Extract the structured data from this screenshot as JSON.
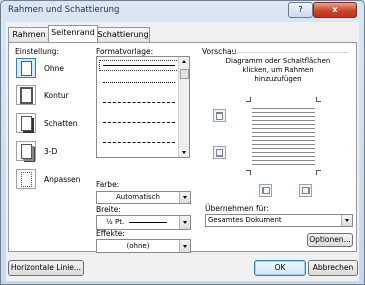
{
  "window": {
    "title": "Rahmen und Schattierung",
    "help_label": "?",
    "close_label": "x"
  },
  "tabs": [
    {
      "label": "Rahmen"
    },
    {
      "label": "Seitenrand"
    },
    {
      "label": "Schattierung"
    }
  ],
  "settings": {
    "heading": "Einstellung:",
    "items": [
      {
        "label": "Ohne"
      },
      {
        "label": "Kontur"
      },
      {
        "label": "Schatten"
      },
      {
        "label": "3-D"
      },
      {
        "label": "Anpassen"
      }
    ]
  },
  "style": {
    "heading": "Formatvorlage:"
  },
  "color": {
    "label": "Farbe:",
    "value": "Automatisch"
  },
  "width": {
    "label": "Breite:",
    "value": "½ Pt."
  },
  "effect": {
    "label": "Effekte:",
    "value": "(ohne)"
  },
  "preview": {
    "heading": "Vorschau",
    "hint_line1": "Diagramm oder Schaltflächen",
    "hint_line2": "klicken, um Rahmen",
    "hint_line3": "hinzuzufügen"
  },
  "apply": {
    "label": "Übernehmen für:",
    "value": "Gesamtes Dokument"
  },
  "buttons": {
    "options": "Optionen...",
    "horizontal_line": "Horizontale Linie...",
    "ok": "OK",
    "cancel": "Abbrechen"
  }
}
